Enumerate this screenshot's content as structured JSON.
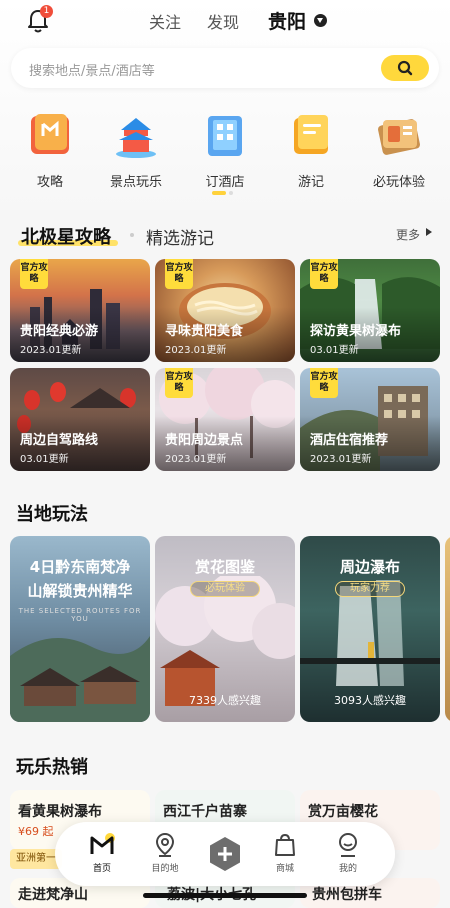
{
  "header": {
    "notification_count": "1",
    "tabs": [
      "关注",
      "发现"
    ],
    "city": "贵阳"
  },
  "search": {
    "placeholder": "搜索地点/景点/酒店等"
  },
  "quick_entries": [
    {
      "label": "攻略",
      "icon": "guide-book-icon"
    },
    {
      "label": "景点玩乐",
      "icon": "temple-icon"
    },
    {
      "label": "订酒店",
      "icon": "hotel-icon"
    },
    {
      "label": "游记",
      "icon": "notebook-icon"
    },
    {
      "label": "必玩体验",
      "icon": "ticket-icon"
    }
  ],
  "guides_section": {
    "tab_active": "北极星攻略",
    "tab_other": "精选游记",
    "more": "更多",
    "badge": "官方攻略",
    "cards": [
      {
        "title": "贵阳经典必游",
        "date": "2023.01更新"
      },
      {
        "title": "寻味贵阳美食",
        "date": "2023.01更新"
      },
      {
        "title": "探访黄果树瀑布",
        "date": "03.01更新"
      },
      {
        "title": "周边自驾路线",
        "date": "03.01更新"
      },
      {
        "title": "贵阳周边景点",
        "date": "2023.01更新"
      },
      {
        "title": "酒店住宿推荐",
        "date": "2023.01更新"
      }
    ]
  },
  "local_section": {
    "title": "当地玩法",
    "cards": [
      {
        "title_line1": "4日黔东南梵净",
        "title_line2": "山解锁贵州精华",
        "subtitle": "THE SELECTED ROUTES FOR YOU",
        "chip": "",
        "interest": ""
      },
      {
        "title_line1": "赏花图鉴",
        "title_line2": "",
        "subtitle": "",
        "chip": "必玩体验",
        "interest": "7339人感兴趣"
      },
      {
        "title_line1": "周边瀑布",
        "title_line2": "",
        "subtitle": "",
        "chip": "玩家力荐",
        "interest": "3093人感兴趣"
      }
    ]
  },
  "hot_section": {
    "title": "玩乐热销",
    "cards": [
      {
        "title": "看黄果树瀑布",
        "price": "¥69 起"
      },
      {
        "title": "西江千户苗寨",
        "price": ""
      },
      {
        "title": "赏万亩樱花",
        "price": ""
      }
    ],
    "tag": "亚洲第一",
    "more_cards": [
      "走进梵净山",
      "荔波|大小七孔",
      "贵州包拼车"
    ]
  },
  "nav": {
    "items": [
      {
        "label": "首页",
        "icon": "home-icon"
      },
      {
        "label": "目的地",
        "icon": "location-pin-icon"
      },
      {
        "label": "商城",
        "icon": "shopping-bag-icon"
      },
      {
        "label": "我的",
        "icon": "profile-icon"
      }
    ]
  },
  "colors": {
    "accent_yellow": "#ffd83c",
    "badge_red": "#f04d3a",
    "price_orange": "#d74e1e"
  }
}
